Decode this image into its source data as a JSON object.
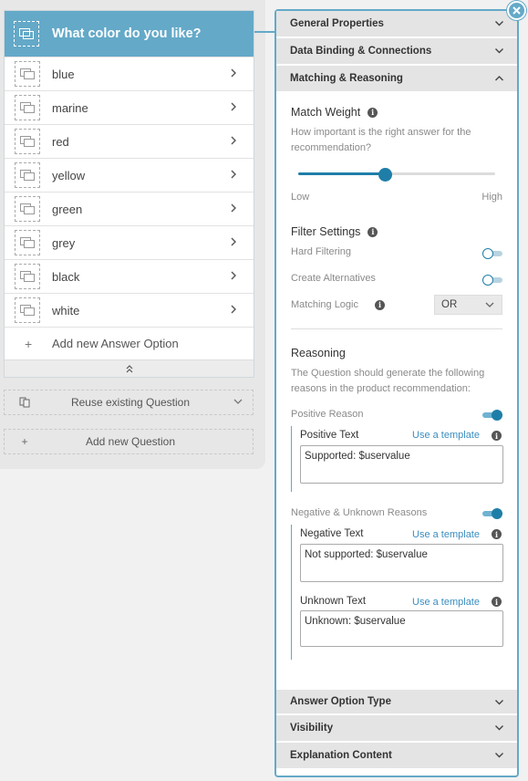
{
  "question": {
    "title": "What color do you like?",
    "answers": [
      {
        "label": "blue"
      },
      {
        "label": "marine"
      },
      {
        "label": "red"
      },
      {
        "label": "yellow"
      },
      {
        "label": "green"
      },
      {
        "label": "grey"
      },
      {
        "label": "black"
      },
      {
        "label": "white"
      }
    ],
    "add_answer_label": "Add new Answer Option",
    "reuse_label": "Reuse existing Question",
    "add_question_label": "Add new Question"
  },
  "panel": {
    "sections_top": [
      "General Properties",
      "Data Binding & Connections",
      "Matching & Reasoning"
    ],
    "match_weight": {
      "title": "Match Weight",
      "help": "How important is the right answer for the recommendation?",
      "low": "Low",
      "high": "High",
      "value_fraction": 0.44
    },
    "filter": {
      "title": "Filter Settings",
      "hard_filtering": "Hard Filtering",
      "create_alternatives": "Create Alternatives",
      "matching_logic": "Matching Logic",
      "matching_logic_value": "OR"
    },
    "reasoning": {
      "title": "Reasoning",
      "help": "The Question should generate the following reasons in the product recommendation:",
      "positive_reason": "Positive Reason",
      "positive_text_label": "Positive Text",
      "positive_text": "Supported: $uservalue",
      "negative_unknown": "Negative & Unknown Reasons",
      "negative_text_label": "Negative Text",
      "negative_text": "Not supported: $uservalue",
      "unknown_text_label": "Unknown Text",
      "unknown_text": "Unknown: $uservalue",
      "use_template": "Use a template"
    },
    "sections_bottom": [
      "Answer Option Type",
      "Visibility",
      "Explanation Content"
    ]
  },
  "colors": {
    "accent": "#64a9c8",
    "toggle": "#1f7ea8",
    "link": "#3a8dc0"
  },
  "icons": [
    "image-thumbnail-icon",
    "chevron-right-icon",
    "plus-icon",
    "double-chevron-up-icon",
    "copy-icon",
    "chevron-down-icon",
    "chevron-up-icon",
    "info-icon",
    "close-icon"
  ]
}
